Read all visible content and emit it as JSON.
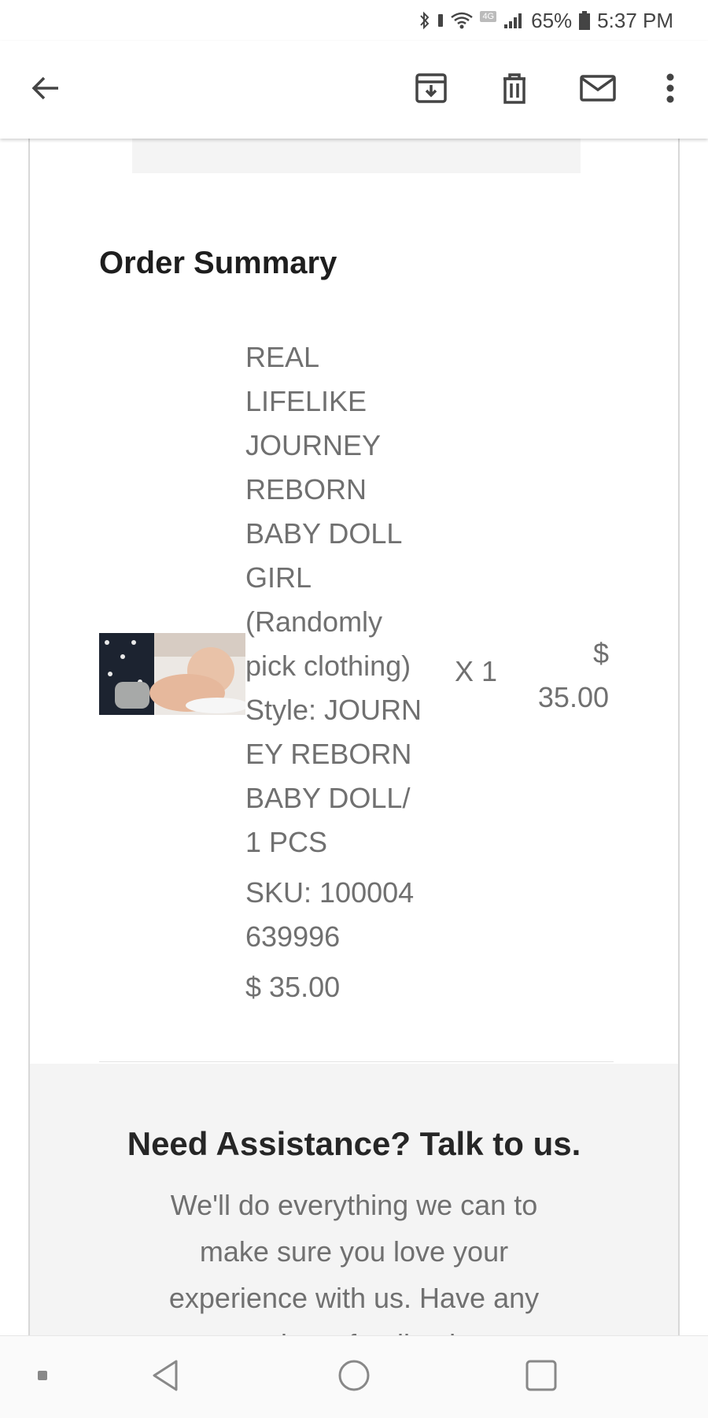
{
  "status_bar": {
    "icons": [
      "bluetooth-icon",
      "vibrate-icon",
      "wifi-icon",
      "lte-icon",
      "signal-icon",
      "battery-icon"
    ],
    "lte_label": "4G",
    "battery": "65%",
    "time": "5:37 PM"
  },
  "app_bar": {
    "icons": [
      "back-arrow-icon",
      "archive-icon",
      "delete-icon",
      "mark-unread-icon",
      "more-vert-icon"
    ]
  },
  "order": {
    "title": "Order Summary",
    "item": {
      "name_lines": [
        "REAL",
        "LIFELIKE",
        "JOURNEY",
        "REBORN",
        "BABY DOLL",
        "GIRL",
        "(Randomly",
        "pick clothing)"
      ],
      "style_lines": [
        "Style: JOURN",
        "EY REBORN",
        "BABY DOLL/",
        "1 PCS"
      ],
      "sku_lines": [
        "SKU: 100004",
        "639996"
      ],
      "unit_price": "$ 35.00",
      "quantity": "X 1",
      "total_lines": [
        "$",
        "35.00"
      ]
    }
  },
  "assistance": {
    "title": "Need Assistance? Talk to us.",
    "body_lines": [
      "We'll do everything we can to",
      "make sure you love your",
      "experience with us. Have any",
      "questions, feedback or"
    ]
  },
  "nav_bar": {
    "icons": [
      "nav-dot-icon",
      "nav-back-icon",
      "nav-home-icon",
      "nav-recents-icon"
    ]
  },
  "colors": {
    "text_dark": "#1e1e1e",
    "text_gray": "#707070",
    "panel_gray": "#f4f4f4"
  }
}
